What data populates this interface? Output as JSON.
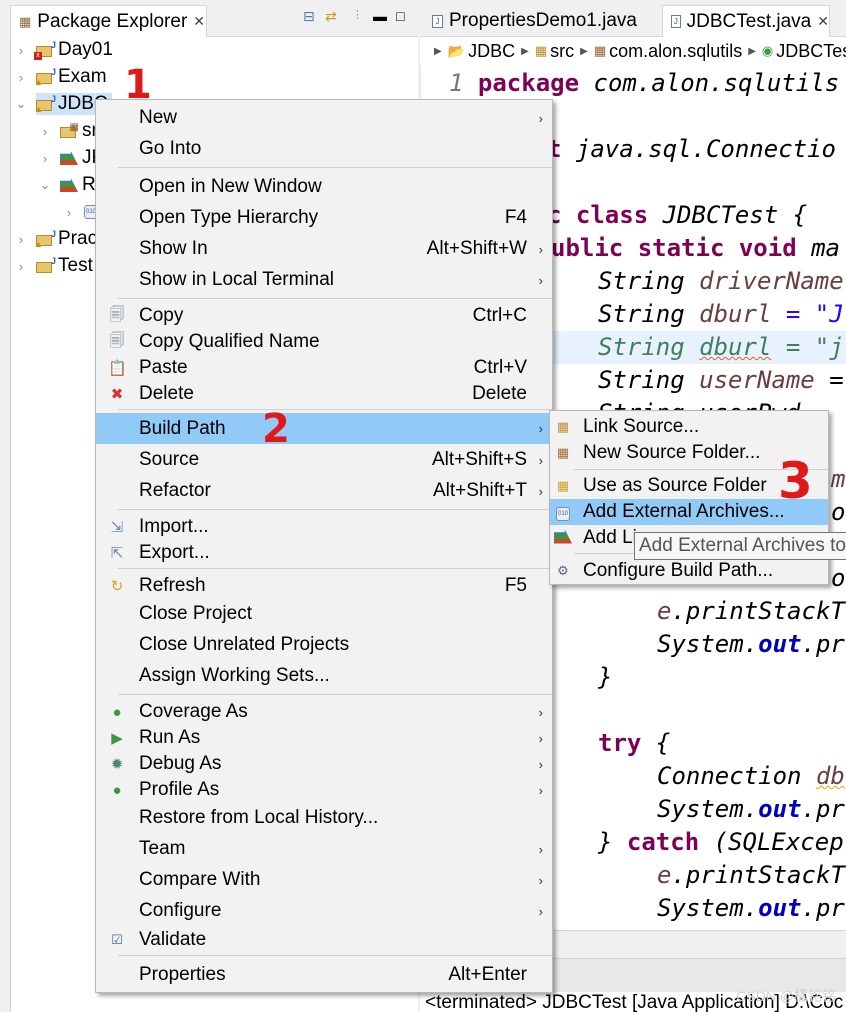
{
  "package_explorer": {
    "tab_label": "Package Explorer",
    "toolbar_icons": [
      "collapse-all-icon",
      "link-with-editor-icon",
      "view-menu-icon",
      "minimize-icon",
      "maximize-icon"
    ],
    "tree": [
      {
        "label": "Day01",
        "expanded": false,
        "icon": "project-error-icon"
      },
      {
        "label": "Exam",
        "expanded": false,
        "icon": "project-warning-icon"
      },
      {
        "label": "JDBC",
        "expanded": true,
        "icon": "project-warning-icon",
        "selected": true
      },
      {
        "label": "src",
        "expanded": false,
        "icon": "source-folder-icon"
      },
      {
        "label": "JRE System Library",
        "expanded": false,
        "icon": "library-icon"
      },
      {
        "label": "Referenced Libraries",
        "expanded": true,
        "icon": "library-icon"
      },
      {
        "label": "",
        "expanded": false,
        "icon": "jar-icon"
      },
      {
        "label": "Practice",
        "expanded": false,
        "icon": "project-warning-icon"
      },
      {
        "label": "Test",
        "expanded": false,
        "icon": "project-icon"
      }
    ]
  },
  "editor": {
    "tabs": [
      {
        "label": "PropertiesDemo1.java",
        "active": false
      },
      {
        "label": "JDBCTest.java",
        "active": true
      }
    ],
    "breadcrumb": [
      "JDBC",
      "src",
      "com.alon.sqlutils",
      "JDBCTest"
    ],
    "line_number": "1",
    "code": {
      "l1_kw": "package",
      "l1_rest": " com.alon.sqlutils",
      "l2_kw": "t",
      "l2_rest": " java.sql.Connectio",
      "l3_kw": "c class",
      "l3_rest": " JDBCTest {",
      "l4_kw": "ublic static void",
      "l4_rest": " ma",
      "l5_type": "String ",
      "l5_var": "driverName",
      "l6_type": "String ",
      "l6_var": "dburl",
      "l6_rest": " = \"J",
      "l7_cmt1": "String ",
      "l7_cmt2": "dburl",
      "l7_cmt3": " = \"j",
      "l8_type": "String ",
      "l8_var": "userName",
      "l8_rest": " =",
      "l9_text": "String userPwd",
      "l10_rest": "me",
      "l11_rest": "or",
      "l13_rest": "ot",
      "l14_var": "e",
      "l14_rest": ".printStackT",
      "l15_a": "System.",
      "l15_fld": "out",
      "l15_b": ".pr",
      "l16": "}",
      "l18_kw": "try",
      "l18_rest": " {",
      "l19_type": "Connection ",
      "l19_var": "db",
      "l20_a": "System.",
      "l20_fld": "out",
      "l20_b": ".pr",
      "l21_a": "} ",
      "l21_kw": "catch",
      "l21_b": " (SQLExcep",
      "l22_var": "e",
      "l22_rest": ".printStackT",
      "l23_a": "System.",
      "l23_fld": "out",
      "l23_b": ".pr"
    }
  },
  "console": {
    "text": "<terminated> JDBCTest [Java Application] D:\\Coc"
  },
  "watermark": "CSDN @橘铭铭",
  "context_menu": {
    "items": [
      {
        "label": "New",
        "shortcut": "",
        "submenu": true
      },
      {
        "label": "Go Into",
        "shortcut": "",
        "submenu": false
      },
      {
        "label": "Open in New Window",
        "shortcut": "",
        "submenu": false
      },
      {
        "label": "Open Type Hierarchy",
        "shortcut": "F4",
        "submenu": false
      },
      {
        "label": "Show In",
        "shortcut": "Alt+Shift+W",
        "submenu": true
      },
      {
        "label": "Show in Local Terminal",
        "shortcut": "",
        "submenu": true
      },
      {
        "label": "Copy",
        "shortcut": "Ctrl+C",
        "icon": "copy-icon"
      },
      {
        "label": "Copy Qualified Name",
        "shortcut": "",
        "icon": "copy-qualified-name-icon"
      },
      {
        "label": "Paste",
        "shortcut": "Ctrl+V",
        "icon": "paste-icon"
      },
      {
        "label": "Delete",
        "shortcut": "Delete",
        "icon": "delete-icon"
      },
      {
        "label": "Build Path",
        "shortcut": "",
        "submenu": true,
        "highlighted": true
      },
      {
        "label": "Source",
        "shortcut": "Alt+Shift+S",
        "submenu": true
      },
      {
        "label": "Refactor",
        "shortcut": "Alt+Shift+T",
        "submenu": true
      },
      {
        "label": "Import...",
        "shortcut": "",
        "icon": "import-icon"
      },
      {
        "label": "Export...",
        "shortcut": "",
        "icon": "export-icon"
      },
      {
        "label": "Refresh",
        "shortcut": "F5",
        "icon": "refresh-icon"
      },
      {
        "label": "Close Project",
        "shortcut": ""
      },
      {
        "label": "Close Unrelated Projects",
        "shortcut": ""
      },
      {
        "label": "Assign Working Sets...",
        "shortcut": ""
      },
      {
        "label": "Coverage As",
        "shortcut": "",
        "submenu": true,
        "icon": "coverage-icon"
      },
      {
        "label": "Run As",
        "shortcut": "",
        "submenu": true,
        "icon": "run-icon"
      },
      {
        "label": "Debug As",
        "shortcut": "",
        "submenu": true,
        "icon": "debug-icon"
      },
      {
        "label": "Profile As",
        "shortcut": "",
        "submenu": true,
        "icon": "profile-icon"
      },
      {
        "label": "Restore from Local History...",
        "shortcut": ""
      },
      {
        "label": "Team",
        "shortcut": "",
        "submenu": true
      },
      {
        "label": "Compare With",
        "shortcut": "",
        "submenu": true
      },
      {
        "label": "Configure",
        "shortcut": "",
        "submenu": true
      },
      {
        "label": "Validate",
        "shortcut": "",
        "icon": "validate-checkbox-icon"
      },
      {
        "label": "Properties",
        "shortcut": "Alt+Enter"
      }
    ]
  },
  "build_path_submenu": {
    "items": [
      {
        "label": "Link Source...",
        "icon": "link-source-icon"
      },
      {
        "label": "New Source Folder...",
        "icon": "new-source-folder-icon"
      },
      {
        "label": "Use as Source Folder",
        "icon": "use-as-source-folder-icon"
      },
      {
        "label": "Add External Archives...",
        "icon": "jar-icon",
        "highlighted": true
      },
      {
        "label": "Add Libraries...",
        "visible_label": "Add Li",
        "icon": "library-icon"
      },
      {
        "label": "Configure Build Path...",
        "icon": "configure-build-path-icon"
      }
    ]
  },
  "tooltip": "Add External Archives to",
  "annotations": [
    "1",
    "2",
    "3"
  ],
  "colors": {
    "menu_highlight": "#91c9f7",
    "tree_selection": "#cce4f7",
    "keyword": "#7f0055",
    "field": "#0000c0",
    "variable": "#6a3e3e",
    "comment": "#3f7f5f",
    "annotation_red": "#e01818"
  }
}
